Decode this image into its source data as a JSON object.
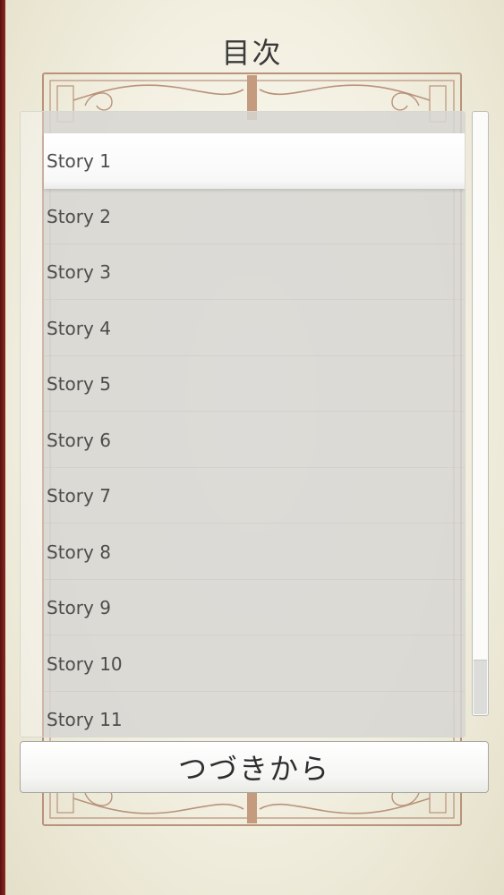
{
  "header": {
    "title": "目次"
  },
  "toc": {
    "items": [
      {
        "label": "Story 1",
        "selected": true
      },
      {
        "label": "Story 2",
        "selected": false
      },
      {
        "label": "Story 3",
        "selected": false
      },
      {
        "label": "Story 4",
        "selected": false
      },
      {
        "label": "Story 5",
        "selected": false
      },
      {
        "label": "Story 6",
        "selected": false
      },
      {
        "label": "Story 7",
        "selected": false
      },
      {
        "label": "Story 8",
        "selected": false
      },
      {
        "label": "Story 9",
        "selected": false
      },
      {
        "label": "Story 10",
        "selected": false
      },
      {
        "label": "Story 11",
        "selected": false
      }
    ]
  },
  "actions": {
    "continue_label": "つづきから"
  },
  "colors": {
    "accent_frame": "#b9927a",
    "edge_red": "#7a1c16",
    "text": "#4d4d4d"
  }
}
